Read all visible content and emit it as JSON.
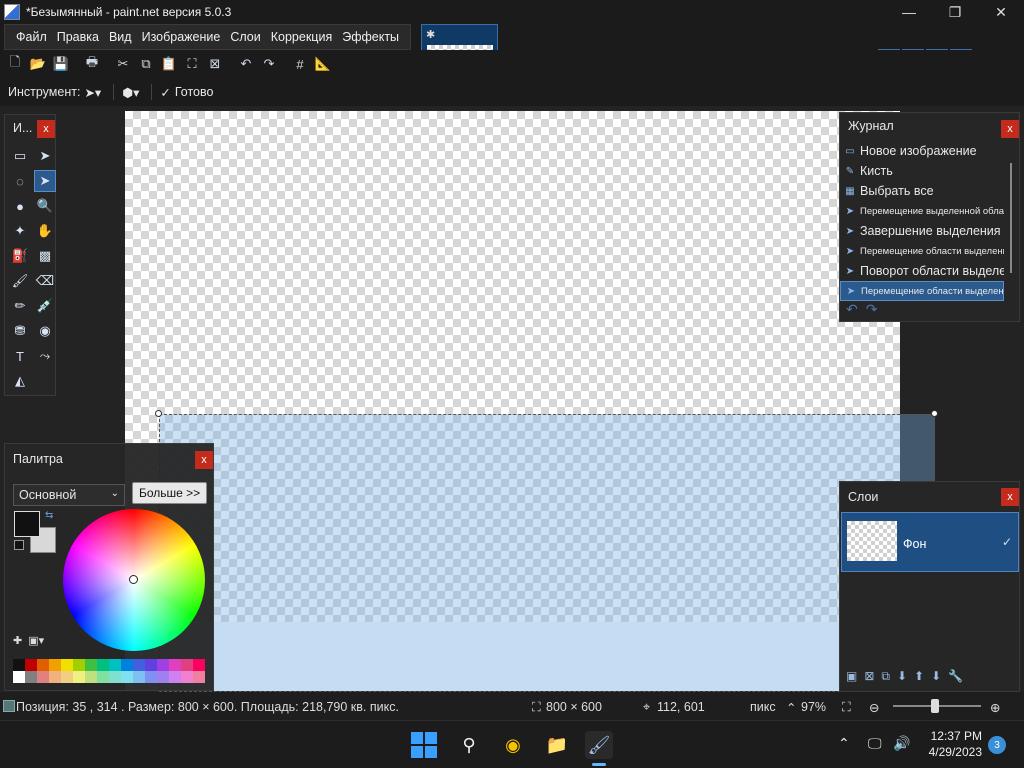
{
  "window": {
    "title": "*Безымянный - paint.net версия 5.0.3",
    "minimize": "—",
    "maximize": "❐",
    "close": "✕"
  },
  "menu": {
    "items": [
      "Файл",
      "Правка",
      "Вид",
      "Изображение",
      "Слои",
      "Коррекция",
      "Эффекты"
    ]
  },
  "options_bar": {
    "tool_label": "Инструмент:",
    "done_label": "Готово"
  },
  "tools_panel": {
    "title": "И...",
    "close": "x"
  },
  "palette_panel": {
    "title": "Палитра",
    "close": "x",
    "mode": "Основной",
    "more_button": "Больше >>",
    "swatches": [
      "#111111",
      "#c00000",
      "#e06000",
      "#f0a000",
      "#f0e000",
      "#a0d000",
      "#40c040",
      "#00c080",
      "#00c0c0",
      "#0080e0",
      "#4060e0",
      "#6040e0",
      "#a040e0",
      "#e040c0",
      "#e04080",
      "#ff0060",
      "#ffffff",
      "#808080",
      "#e08080",
      "#f0b080",
      "#f0d080",
      "#f0f080",
      "#c0e080",
      "#80e0a0",
      "#80e0d0",
      "#80e0f0",
      "#80c0f0",
      "#8090f0",
      "#a080f0",
      "#d080f0",
      "#f080d0",
      "#f080a0"
    ]
  },
  "history_panel": {
    "title": "Журнал",
    "close": "x",
    "items": [
      {
        "label": "Новое изображение",
        "small": false,
        "active": false,
        "icon": "▭"
      },
      {
        "label": "Кисть",
        "small": false,
        "active": false,
        "icon": "✎"
      },
      {
        "label": "Выбрать все",
        "small": false,
        "active": false,
        "icon": "▦"
      },
      {
        "label": "Перемещение выделенной области",
        "small": true,
        "active": false,
        "icon": "➤"
      },
      {
        "label": "Завершение выделения",
        "small": false,
        "active": false,
        "icon": "➤"
      },
      {
        "label": "Перемещение области выделения",
        "small": true,
        "active": false,
        "icon": "➤"
      },
      {
        "label": "Поворот области выделения",
        "small": false,
        "active": false,
        "icon": "➤"
      },
      {
        "label": "Перемещение области выделения",
        "small": true,
        "active": true,
        "icon": "➤"
      }
    ]
  },
  "layers_panel": {
    "title": "Слои",
    "close": "x",
    "layer_name": "Фон"
  },
  "status": {
    "text": "Позиция: 35 , 314 . Размер: 800 × 600. Площадь: 218,790 кв. пикс.",
    "image_size": "800 × 600",
    "cursor": "112, 601",
    "units": "пикс",
    "zoom": "97%"
  },
  "taskbar": {
    "time": "12:37 PM",
    "date": "4/29/2023",
    "notifications": "3"
  },
  "colors": {
    "accent": "#2b5a8e",
    "close_red": "#c42b1c"
  }
}
